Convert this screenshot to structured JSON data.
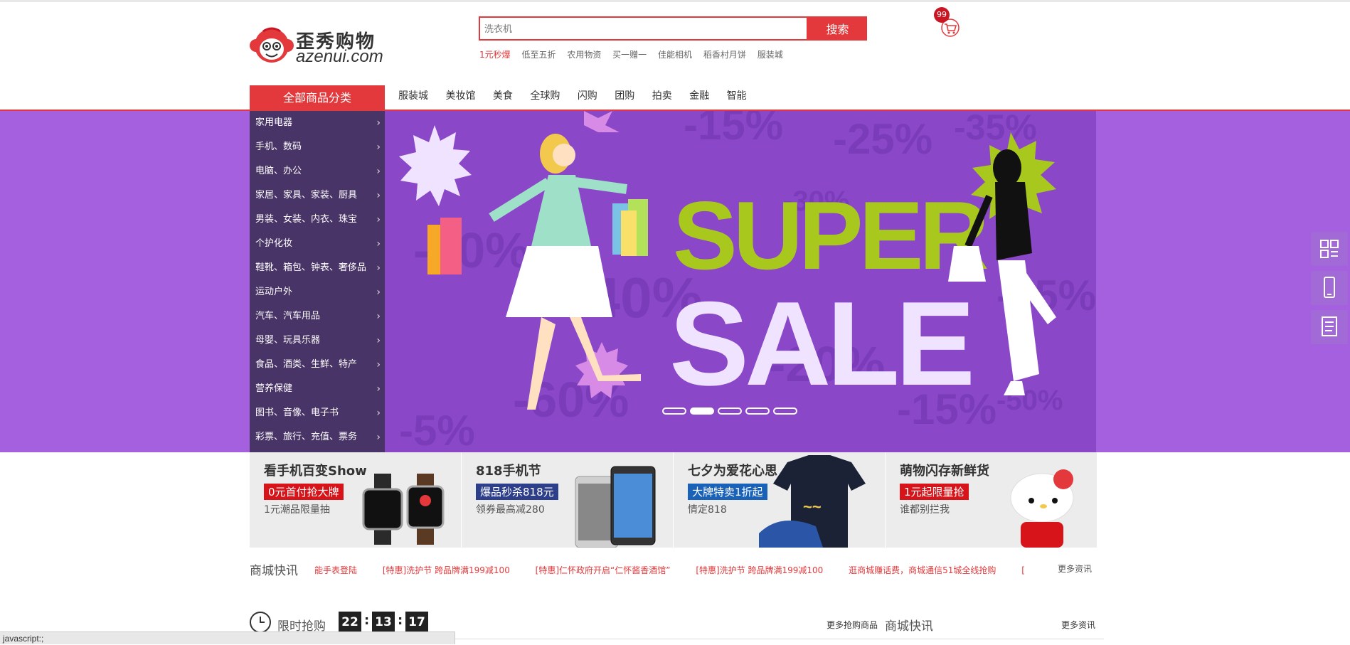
{
  "logo": {
    "title": "歪秀购物",
    "subtitle": "azenui.com",
    "icon": "monkey-logo-icon"
  },
  "search": {
    "placeholder": "洗衣机",
    "button": "搜索"
  },
  "hotwords": [
    "1元秒爆",
    "低至五折",
    "农用物资",
    "买一赠一",
    "佳能相机",
    "稻香村月饼",
    "服装城"
  ],
  "cart": {
    "count": "99",
    "icon": "cart-icon"
  },
  "nav": {
    "all_categories": "全部商品分类",
    "items": [
      "服装城",
      "美妆馆",
      "美食",
      "全球购",
      "闪购",
      "团购",
      "拍卖",
      "金融",
      "智能"
    ]
  },
  "categories": [
    "家用电器",
    "手机、数码",
    "电脑、办公",
    "家居、家具、家装、厨具",
    "男装、女装、内衣、珠宝",
    "个护化妆",
    "鞋靴、箱包、钟表、奢侈品",
    "运动户外",
    "汽车、汽车用品",
    "母婴、玩具乐器",
    "食品、酒类、生鲜、特产",
    "营养保健",
    "图书、音像、电子书",
    "彩票、旅行、充值、票务"
  ],
  "banner": {
    "text_line1": "SUPER",
    "text_line2": "SALE",
    "slides": 5,
    "active_slide": 2,
    "bg_color": "#a560e0",
    "accent_green": "#a8c81e"
  },
  "side_tools": [
    "qrcode-icon",
    "mobile-icon",
    "document-icon"
  ],
  "promos": [
    {
      "title": "看手机百变Show",
      "tag": "0元首付抢大牌",
      "tag_color": "#d7141a",
      "sub": "1元潮品限量抽"
    },
    {
      "title": "818手机节",
      "tag": "爆品秒杀818元",
      "tag_color": "#2d3e8a",
      "sub": "领券最高减280"
    },
    {
      "title": "七夕为爱花心思",
      "tag": "大牌特卖1折起",
      "tag_color": "#1a62b8",
      "sub": "情定818"
    },
    {
      "title": "萌物闪存新鲜货",
      "tag": "1元起限量抢",
      "tag_color": "#d7141a",
      "sub": "谁都别拦我"
    }
  ],
  "news": {
    "title": "商城快讯",
    "items": [
      "能手表登陆",
      "[特惠]洗护节 跨品牌满199减100",
      "[特惠]仁怀政府开启“仁怀酱香酒馆”",
      "[特惠]洗护节 跨品牌满199减100",
      "逛商城赚话费，商城通信51城全线抢购",
      "["
    ],
    "more": "更多资讯"
  },
  "flash": {
    "title": "限时抢购",
    "hours": "22",
    "minutes": "13",
    "seconds": "17",
    "more": "更多抢购商品"
  },
  "news2": {
    "title": "商城快讯",
    "more": "更多资讯"
  },
  "statusbar": "javascript:;"
}
